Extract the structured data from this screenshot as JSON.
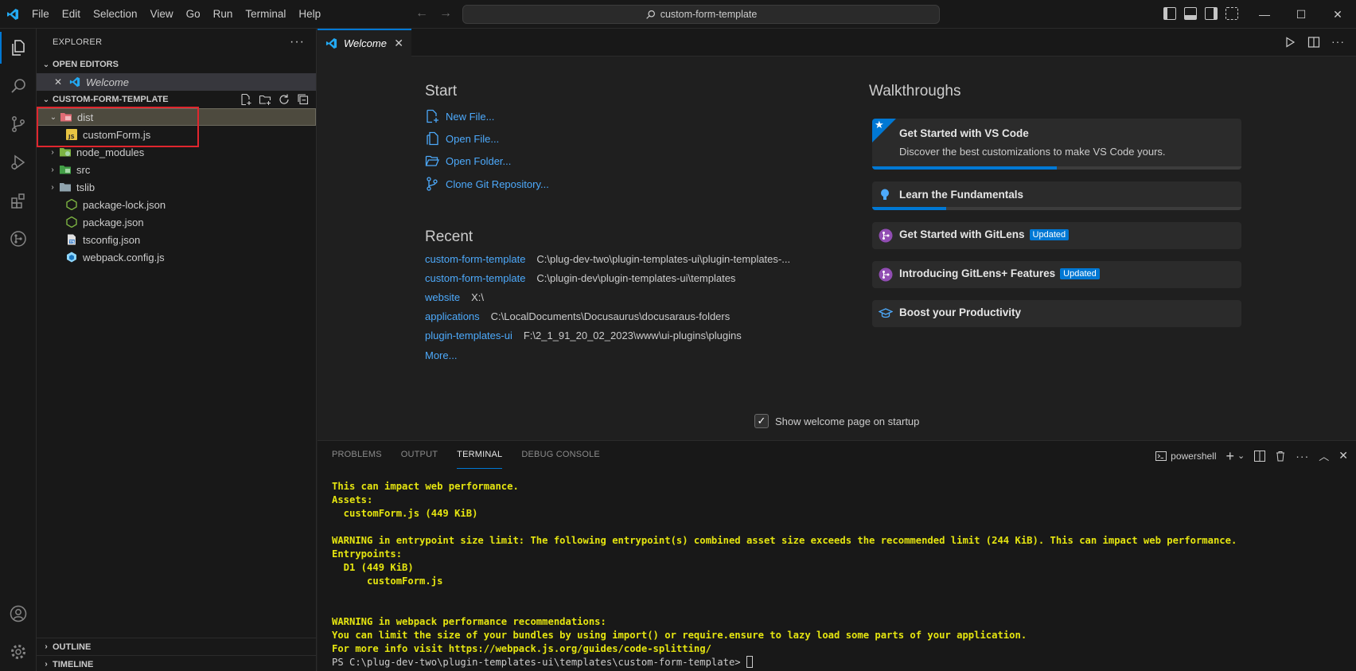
{
  "menu": [
    "File",
    "Edit",
    "Selection",
    "View",
    "Go",
    "Run",
    "Terminal",
    "Help"
  ],
  "command_center": "custom-form-template",
  "explorer": {
    "title": "EXPLORER",
    "open_editors_label": "OPEN EDITORS",
    "open_editor_item": "Welcome",
    "project_label": "CUSTOM-FORM-TEMPLATE",
    "tree": [
      {
        "label": "dist",
        "type": "folder",
        "expanded": true
      },
      {
        "label": "customForm.js",
        "type": "js"
      },
      {
        "label": "node_modules",
        "type": "folder"
      },
      {
        "label": "src",
        "type": "folder"
      },
      {
        "label": "tslib",
        "type": "folder"
      },
      {
        "label": "package-lock.json",
        "type": "json"
      },
      {
        "label": "package.json",
        "type": "json"
      },
      {
        "label": "tsconfig.json",
        "type": "tsjson"
      },
      {
        "label": "webpack.config.js",
        "type": "webpack"
      }
    ],
    "outline_label": "OUTLINE",
    "timeline_label": "TIMELINE"
  },
  "tab": {
    "label": "Welcome"
  },
  "welcome": {
    "start_heading": "Start",
    "start_links": [
      "New File...",
      "Open File...",
      "Open Folder...",
      "Clone Git Repository..."
    ],
    "recent_heading": "Recent",
    "recent": [
      {
        "name": "custom-form-template",
        "path": "C:\\plug-dev-two\\plugin-templates-ui\\plugin-templates-..."
      },
      {
        "name": "custom-form-template",
        "path": "C:\\plugin-dev\\plugin-templates-ui\\templates"
      },
      {
        "name": "website",
        "path": "X:\\"
      },
      {
        "name": "applications",
        "path": "C:\\LocalDocuments\\Docusaurus\\docusaraus-folders"
      },
      {
        "name": "plugin-templates-ui",
        "path": "F:\\2_1_91_20_02_2023\\www\\ui-plugins\\plugins"
      }
    ],
    "more_label": "More...",
    "walkthroughs_heading": "Walkthroughs",
    "walkthroughs": [
      {
        "title": "Get Started with VS Code",
        "desc": "Discover the best customizations to make VS Code yours.",
        "progress": 0.5
      },
      {
        "title": "Learn the Fundamentals",
        "progress": 0.2
      },
      {
        "title": "Get Started with GitLens",
        "badge": "Updated"
      },
      {
        "title": "Introducing GitLens+ Features",
        "badge": "Updated"
      },
      {
        "title": "Boost your Productivity"
      }
    ],
    "startup_label": "Show welcome page on startup"
  },
  "panel": {
    "tabs": [
      "PROBLEMS",
      "OUTPUT",
      "TERMINAL",
      "DEBUG CONSOLE"
    ],
    "shell": "powershell",
    "terminal_lines": [
      {
        "text": "This can impact web performance.",
        "style": "y"
      },
      {
        "text": "Assets:",
        "style": "y"
      },
      {
        "text": "  customForm.js (449 KiB)",
        "style": "y"
      },
      {
        "text": "",
        "style": "w"
      },
      {
        "text": "WARNING in entrypoint size limit: The following entrypoint(s) combined asset size exceeds the recommended limit (244 KiB). This can impact web performance.",
        "style": "y"
      },
      {
        "text": "Entrypoints:",
        "style": "y"
      },
      {
        "text": "  D1 (449 KiB)",
        "style": "y"
      },
      {
        "text": "      customForm.js",
        "style": "y"
      },
      {
        "text": "",
        "style": "w"
      },
      {
        "text": "",
        "style": "w"
      },
      {
        "text": "WARNING in webpack performance recommendations:",
        "style": "y"
      },
      {
        "text": "You can limit the size of your bundles by using import() or require.ensure to lazy load some parts of your application.",
        "style": "y"
      },
      {
        "text": "For more info visit https://webpack.js.org/guides/code-splitting/",
        "style": "y"
      }
    ],
    "prompt": "PS C:\\plug-dev-two\\plugin-templates-ui\\templates\\custom-form-template> "
  }
}
